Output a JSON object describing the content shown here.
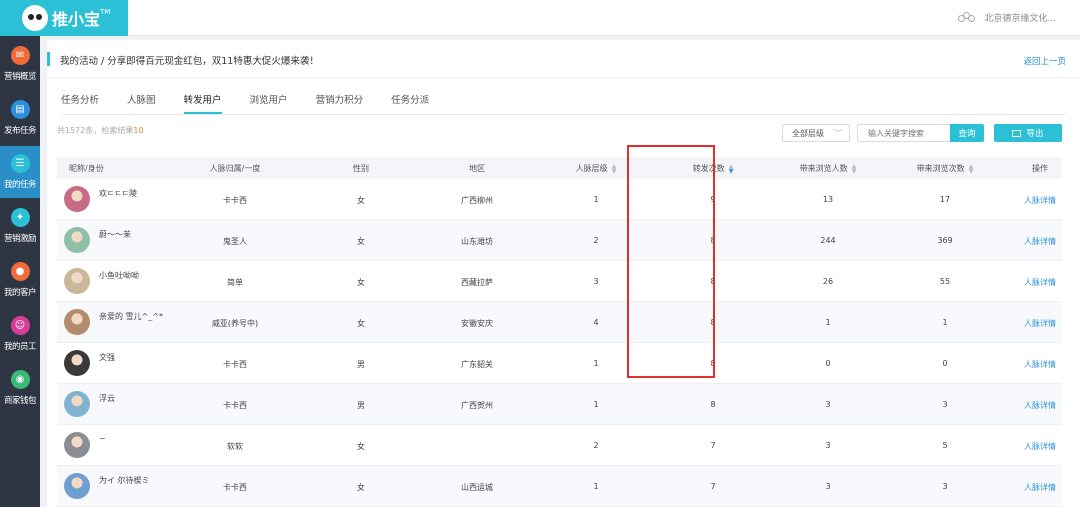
{
  "logo": {
    "text": "推小宝",
    "tm": "TM"
  },
  "company": "北京德京缘文化...",
  "sidebar": {
    "items": [
      {
        "label": "营销概览",
        "color": "#f26b3a",
        "glyph": "✉"
      },
      {
        "label": "发布任务",
        "color": "#2b90d9",
        "glyph": "▤"
      },
      {
        "label": "我的任务",
        "color": "#2bc0d6",
        "glyph": "☰",
        "active": true
      },
      {
        "label": "营销激励",
        "color": "#2bc0d6",
        "glyph": "✦"
      },
      {
        "label": "我的客户",
        "color": "#f26b3a",
        "glyph": "●"
      },
      {
        "label": "我的员工",
        "color": "#d43f9a",
        "glyph": "☺"
      },
      {
        "label": "商家钱包",
        "color": "#3cb878",
        "glyph": "◉"
      }
    ]
  },
  "breadcrumb": "我的活动 / 分享即得百元现金红包，双11特惠大促火爆来袭！",
  "back_link": "返回上一页",
  "tabs": [
    {
      "label": "任务分析"
    },
    {
      "label": "人脉图"
    },
    {
      "label": "转发用户",
      "active": true
    },
    {
      "label": "浏览用户"
    },
    {
      "label": "营销力积分"
    },
    {
      "label": "任务分派"
    }
  ],
  "summary": {
    "prefix": "共1572条，检索结果",
    "count": "10"
  },
  "level_select": "全部层级",
  "search_placeholder": "输入关键字搜索",
  "query_btn": "查询",
  "export_btn": "导出",
  "columns": [
    "昵称/身份",
    "人脉归属/一度",
    "性别",
    "地区",
    "人脉层级",
    "转发次数",
    "带来浏览人数",
    "带来浏览次数",
    "操作"
  ],
  "rows": [
    {
      "nick": "欢ㄷㄷㄷ陵",
      "owner": "卡卡西",
      "gender": "女",
      "region": "广西柳州",
      "level": "1",
      "forwards": "9",
      "viewers": "13",
      "views": "17",
      "action": "人脉详情",
      "avatar": "#c96a86"
    },
    {
      "nick": "蔚～～茉",
      "owner": "鬼圣人",
      "gender": "女",
      "region": "山东潍坊",
      "level": "2",
      "forwards": "8",
      "viewers": "244",
      "views": "369",
      "action": "人脉详情",
      "avatar": "#8fbfa8"
    },
    {
      "nick": "小鱼吐呦呦",
      "owner": "简单",
      "gender": "女",
      "region": "西藏拉萨",
      "level": "3",
      "forwards": "8",
      "viewers": "26",
      "views": "55",
      "action": "人脉详情",
      "avatar": "#c9b79a"
    },
    {
      "nick": "亲爱的 雪儿^_^*",
      "owner": "威亚(养号中)",
      "gender": "女",
      "region": "安徽安庆",
      "level": "4",
      "forwards": "8",
      "viewers": "1",
      "views": "1",
      "action": "人脉详情",
      "avatar": "#b58a6e"
    },
    {
      "nick": "文强",
      "owner": "卡卡西",
      "gender": "男",
      "region": "广东韶关",
      "level": "1",
      "forwards": "8",
      "viewers": "0",
      "views": "0",
      "action": "人脉详情",
      "avatar": "#3a3a3a"
    },
    {
      "nick": "浮云",
      "owner": "卡卡西",
      "gender": "男",
      "region": "广西贺州",
      "level": "1",
      "forwards": "8",
      "viewers": "3",
      "views": "3",
      "action": "人脉详情",
      "avatar": "#7fb3cf"
    },
    {
      "nick": "~",
      "owner": "软软",
      "gender": "女",
      "region": "",
      "level": "2",
      "forwards": "7",
      "viewers": "3",
      "views": "5",
      "action": "人脉详情",
      "avatar": "#8a8d91"
    },
    {
      "nick": "为イ 尔待楔ミ",
      "owner": "卡卡西",
      "gender": "女",
      "region": "山西运城",
      "level": "1",
      "forwards": "7",
      "viewers": "3",
      "views": "3",
      "action": "人脉详情",
      "avatar": "#6f9fd0"
    }
  ]
}
